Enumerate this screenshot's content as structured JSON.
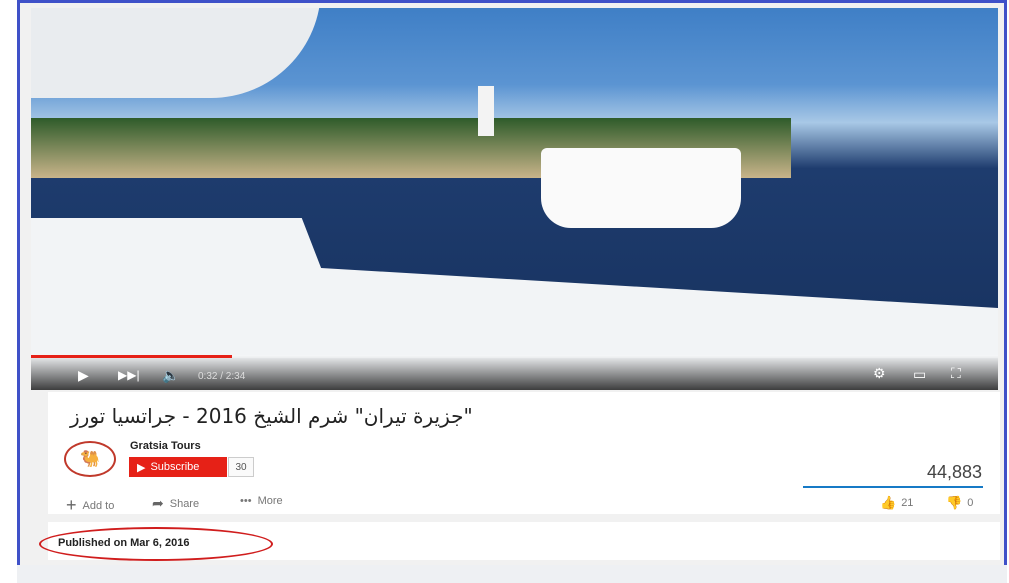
{
  "player": {
    "current_time": "0:32",
    "duration": "2:34",
    "time_display": "0:32 / 2:34",
    "progress_fraction": 0.2078,
    "icons": [
      "play-icon",
      "next-icon",
      "volume-icon",
      "settings-icon",
      "theater-mode-icon",
      "fullscreen-icon"
    ]
  },
  "video": {
    "title": "\"جزيرة تيران\" شرم الشيخ 2016 - جراتسيا تورز",
    "views": "44,883",
    "likes": "21",
    "dislikes": "0"
  },
  "channel": {
    "name": "Gratsia Tours",
    "subscribe_label": "Subscribe",
    "subscriber_count": "30"
  },
  "actions": {
    "add_to": "Add to",
    "share": "Share",
    "more": "More"
  },
  "description": {
    "published": "Published on Mar 6, 2016"
  },
  "colors": {
    "frame_border": "#3f51c8",
    "subscribe_red": "#e62117",
    "views_line": "#167ac6",
    "annotation_oval": "#d01d1d"
  }
}
